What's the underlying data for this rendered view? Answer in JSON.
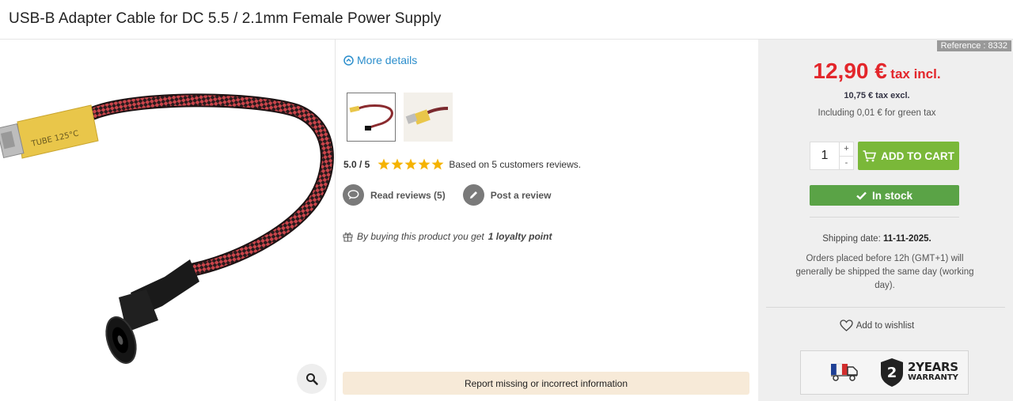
{
  "product": {
    "title": "USB-B Adapter Cable for DC 5.5 / 2.1mm Female Power Supply",
    "cable_label": "TUBE 125°C"
  },
  "details": {
    "more_details": "More details",
    "rating_score": "5.0 / 5",
    "rating_stars": 5,
    "rating_text": "Based on 5 customers reviews.",
    "read_reviews": "Read reviews (5)",
    "post_review": "Post a review",
    "loyalty_prefix": "By buying this product you get",
    "loyalty_points": "1 loyalty point",
    "report_button": "Report missing or incorrect information"
  },
  "buy": {
    "reference": "Reference : 8332",
    "price": "12,90 €",
    "price_suffix": "tax incl.",
    "price_excl": "10,75 € tax excl.",
    "green_tax": "Including 0,01 € for green tax",
    "quantity": "1",
    "qty_plus": "+",
    "qty_minus": "-",
    "add_to_cart": "ADD TO CART",
    "stock_status": "In stock",
    "shipping_label": "Shipping date:",
    "shipping_date": "11-11-2025.",
    "shipping_note": "Orders placed before 12h (GMT+1) will generally be shipped the same day (working day).",
    "wishlist": "Add to wishlist",
    "warranty_big": "2YEARS",
    "warranty_small": "WARRANTY",
    "warranty_digit": "2"
  },
  "colors": {
    "price": "#e3262b",
    "add_to_cart": "#7ab839",
    "in_stock": "#5aa346",
    "link": "#2b8ecc",
    "star": "#f5b301",
    "report_bg": "#f7ead8"
  }
}
